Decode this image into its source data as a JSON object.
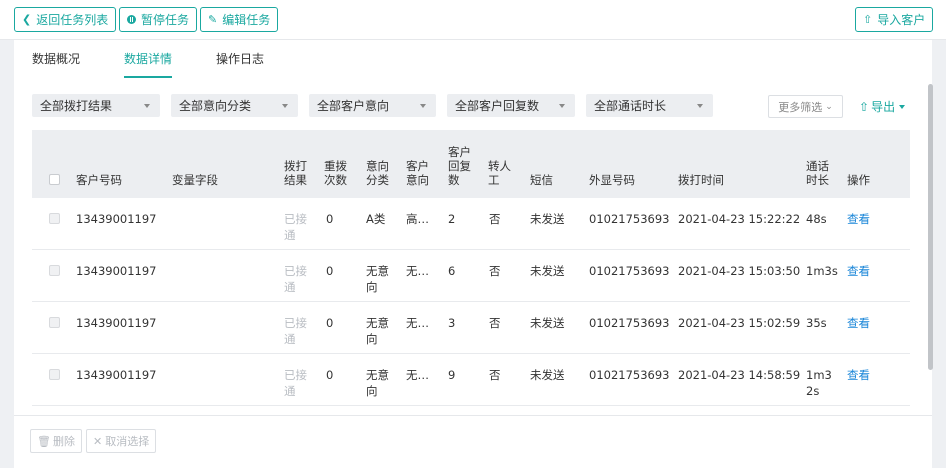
{
  "toolbar": {
    "back_label": "返回任务列表",
    "pause_label": "暂停任务",
    "edit_label": "编辑任务",
    "import_label": "导入客户"
  },
  "tabs": [
    {
      "label": "数据概况",
      "active": false
    },
    {
      "label": "数据详情",
      "active": true
    },
    {
      "label": "操作日志",
      "active": false
    }
  ],
  "filters": {
    "dial_result": "全部拨打结果",
    "intent_class": "全部意向分类",
    "customer_intent": "全部客户意向",
    "customer_reply": "全部客户回复数",
    "call_duration": "全部通话时长",
    "more": "更多筛选",
    "export": "导出"
  },
  "table": {
    "headers": {
      "customer_no": "客户号码",
      "var_field": "变量字段",
      "dial_result": "拨打结果",
      "redial": "重拨次数",
      "intent_class": "意向分类",
      "customer_intent": "客户意向",
      "reply_count": "客户回复数",
      "transfer": "转人工",
      "sms": "短信",
      "caller_no": "外显号码",
      "dial_time": "拨打时间",
      "duration": "通话时长",
      "action": "操作"
    },
    "rows": [
      {
        "customer_no": "13439001197",
        "dial_result": "已接通",
        "redial": "0",
        "intent_class": "A类",
        "customer_intent": "高…",
        "reply_count": "2",
        "transfer": "否",
        "sms": "未发送",
        "caller_no": "01021753693",
        "dial_time": "2021-04-23 15:22:22",
        "duration": "48s",
        "action": "查看"
      },
      {
        "customer_no": "13439001197",
        "dial_result": "已接通",
        "redial": "0",
        "intent_class": "无意向",
        "customer_intent": "无…",
        "reply_count": "6",
        "transfer": "否",
        "sms": "未发送",
        "caller_no": "01021753693",
        "dial_time": "2021-04-23 15:03:50",
        "duration": "1m3s",
        "action": "查看"
      },
      {
        "customer_no": "13439001197",
        "dial_result": "已接通",
        "redial": "0",
        "intent_class": "无意向",
        "customer_intent": "无…",
        "reply_count": "3",
        "transfer": "否",
        "sms": "未发送",
        "caller_no": "01021753693",
        "dial_time": "2021-04-23 15:02:59",
        "duration": "35s",
        "action": "查看"
      },
      {
        "customer_no": "13439001197",
        "dial_result": "已接通",
        "redial": "0",
        "intent_class": "无意向",
        "customer_intent": "无…",
        "reply_count": "9",
        "transfer": "否",
        "sms": "未发送",
        "caller_no": "01021753693",
        "dial_time": "2021-04-23 14:58:59",
        "duration": "1m32s",
        "action": "查看"
      }
    ]
  },
  "footer": {
    "delete_label": "删除",
    "deselect_label": "取消选择"
  },
  "colors": {
    "accent": "#1aa8a0",
    "link": "#1a86d8"
  },
  "icons": [
    "chevron-left-icon",
    "pause-icon",
    "pencil-icon",
    "upload-icon",
    "export-icon",
    "trash-icon",
    "close-icon"
  ]
}
